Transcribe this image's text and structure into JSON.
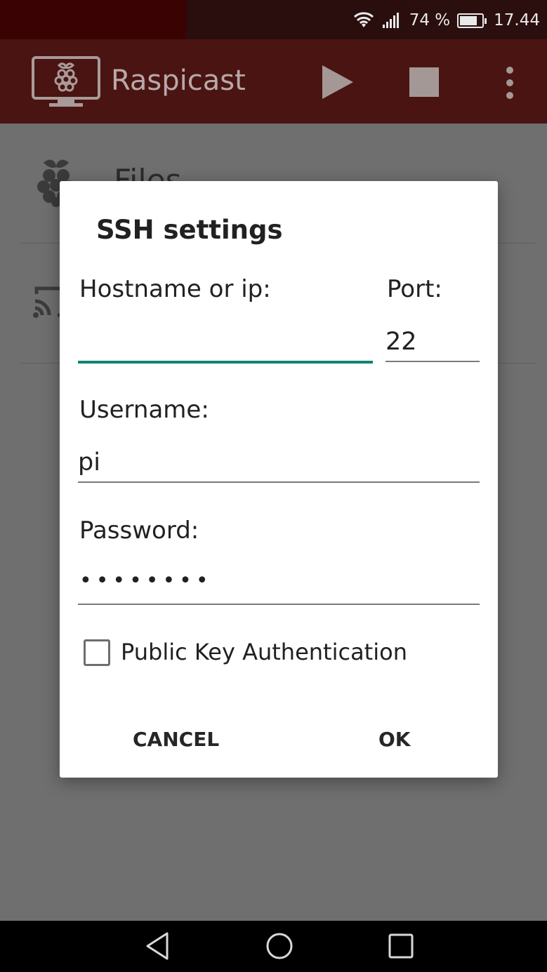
{
  "status_bar": {
    "battery": "74 %",
    "time": "17.44",
    "icons": [
      "wifi-icon",
      "signal-icon",
      "battery-icon"
    ]
  },
  "app_bar": {
    "title": "Raspicast",
    "icons": [
      "raspberry-tv-logo-icon",
      "play-icon",
      "stop-icon",
      "more-vert-icon"
    ],
    "background": "#4a1413"
  },
  "background_list": {
    "items": [
      {
        "label": "Files",
        "icon": "raspberry-icon"
      },
      {
        "label": "",
        "icon": "cast-icon"
      }
    ]
  },
  "dialog": {
    "title": "SSH settings",
    "hostname": {
      "label": "Hostname or ip:",
      "value": ""
    },
    "port": {
      "label": "Port:",
      "value": "22"
    },
    "username": {
      "label": "Username:",
      "value": "pi"
    },
    "password": {
      "label": "Password:",
      "value": "••••••••"
    },
    "public_key": {
      "label": "Public Key Authentication",
      "checked": false
    },
    "buttons": {
      "cancel": "CANCEL",
      "ok": "OK"
    },
    "accent_color": "#0f8576"
  },
  "nav_bar": {
    "icons": [
      "back-icon",
      "home-icon",
      "recents-icon"
    ]
  }
}
